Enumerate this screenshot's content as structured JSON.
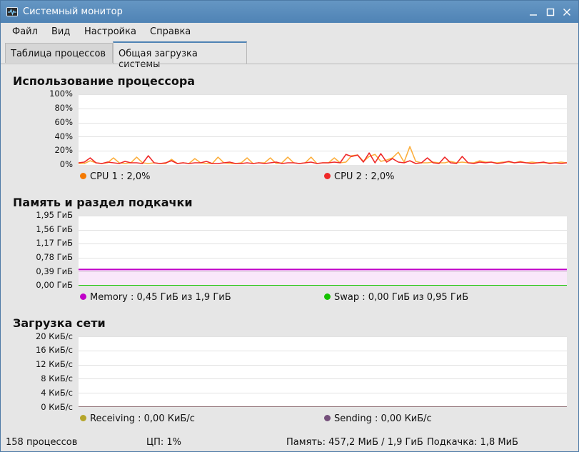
{
  "window": {
    "title": "Системный монитор",
    "icon": "system-monitor-icon",
    "controls": [
      "minimize-icon",
      "maximize-icon",
      "close-icon"
    ]
  },
  "menu": {
    "items": [
      "Файл",
      "Вид",
      "Настройка",
      "Справка"
    ]
  },
  "tabs": [
    {
      "label": "Таблица процессов",
      "active": false
    },
    {
      "label": "Общая загрузка системы",
      "active": true
    }
  ],
  "cpu": {
    "title": "Использование процессора",
    "y_ticks": [
      "100%",
      "80%",
      "60%",
      "40%",
      "20%",
      "0%"
    ],
    "legend": [
      {
        "label": "CPU 1 : 2,0%",
        "color": "#f57900"
      },
      {
        "label": "CPU 2 : 2,0%",
        "color": "#ef2929"
      }
    ]
  },
  "memory": {
    "title": "Память и раздел подкачки",
    "y_ticks": [
      "1,95 ГиБ",
      "1,56 ГиБ",
      "1,17 ГиБ",
      "0,78 ГиБ",
      "0,39 ГиБ",
      "0,00 ГиБ"
    ],
    "legend": [
      {
        "label": "Memory : 0,45 ГиБ из 1,9 ГиБ",
        "color": "#c000c8"
      },
      {
        "label": "Swap : 0,00 ГиБ из 0,95 ГиБ",
        "color": "#15c200"
      }
    ]
  },
  "network": {
    "title": "Загрузка сети",
    "y_ticks": [
      "20 КиБ/с",
      "16 КиБ/с",
      "12 КиБ/с",
      "8 КиБ/с",
      "4 КиБ/с",
      "0 КиБ/с"
    ],
    "legend": [
      {
        "label": "Receiving : 0,00 КиБ/с",
        "color": "#b5a52a"
      },
      {
        "label": "Sending : 0,00 КиБ/с",
        "color": "#75507b"
      }
    ]
  },
  "status": {
    "processes": "158 процессов",
    "cpu": "ЦП: 1%",
    "memory": "Память: 457,2 МиБ / 1,9 ГиБ",
    "swap": "Подкачка: 1,8 МиБ"
  },
  "chart_data": [
    {
      "type": "line",
      "title": "Использование процессора",
      "ylim": [
        0,
        100
      ],
      "y_unit": "%",
      "grid": true,
      "legend_position": "bottom",
      "series": [
        {
          "name": "CPU 1",
          "color": "#fcaf3e",
          "values": [
            2,
            2,
            6,
            3,
            2,
            3,
            10,
            3,
            2,
            3,
            11,
            3,
            2,
            3,
            2,
            2,
            8,
            2,
            3,
            2,
            9,
            3,
            2,
            2,
            11,
            3,
            2,
            2,
            3,
            10,
            2,
            3,
            3,
            10,
            2,
            3,
            11,
            3,
            2,
            3,
            11,
            2,
            3,
            3,
            10,
            3,
            4,
            13,
            14,
            5,
            12,
            15,
            5,
            7,
            10,
            18,
            4,
            26,
            5,
            3,
            3,
            4,
            3,
            3,
            5,
            3,
            4,
            3,
            3,
            6,
            4,
            4,
            3,
            4,
            4,
            3,
            5,
            3,
            4,
            3,
            3,
            3,
            3,
            4,
            3
          ]
        },
        {
          "name": "CPU 2",
          "color": "#ef2929",
          "values": [
            3,
            4,
            10,
            3,
            2,
            4,
            3,
            2,
            5,
            3,
            3,
            2,
            13,
            3,
            2,
            3,
            6,
            2,
            3,
            2,
            3,
            3,
            5,
            2,
            2,
            3,
            4,
            2,
            2,
            3,
            2,
            3,
            2,
            3,
            4,
            2,
            3,
            3,
            2,
            3,
            4,
            2,
            3,
            3,
            4,
            3,
            15,
            12,
            14,
            4,
            17,
            3,
            16,
            4,
            9,
            4,
            3,
            6,
            2,
            3,
            10,
            3,
            2,
            11,
            3,
            2,
            12,
            3,
            2,
            4,
            3,
            4,
            2,
            3,
            5,
            3,
            4,
            3,
            2,
            3,
            4,
            2,
            3,
            2,
            3
          ]
        }
      ]
    },
    {
      "type": "area",
      "title": "Память и раздел подкачки",
      "ylim": [
        0,
        1.95
      ],
      "y_unit": "ГиБ",
      "grid": true,
      "legend_position": "bottom",
      "series": [
        {
          "name": "Memory",
          "color": "#c000c8",
          "values": [
            0.45,
            0.45
          ]
        },
        {
          "name": "Swap",
          "color": "#15c200",
          "values": [
            0.0,
            0.0
          ]
        }
      ]
    },
    {
      "type": "line",
      "title": "Загрузка сети",
      "ylim": [
        0,
        20
      ],
      "y_unit": "КиБ/с",
      "grid": true,
      "legend_position": "bottom",
      "series": [
        {
          "name": "Receiving",
          "color": "#edd400",
          "values": [
            0,
            0
          ]
        },
        {
          "name": "Sending",
          "color": "#75507b",
          "values": [
            0,
            0
          ]
        }
      ]
    }
  ]
}
